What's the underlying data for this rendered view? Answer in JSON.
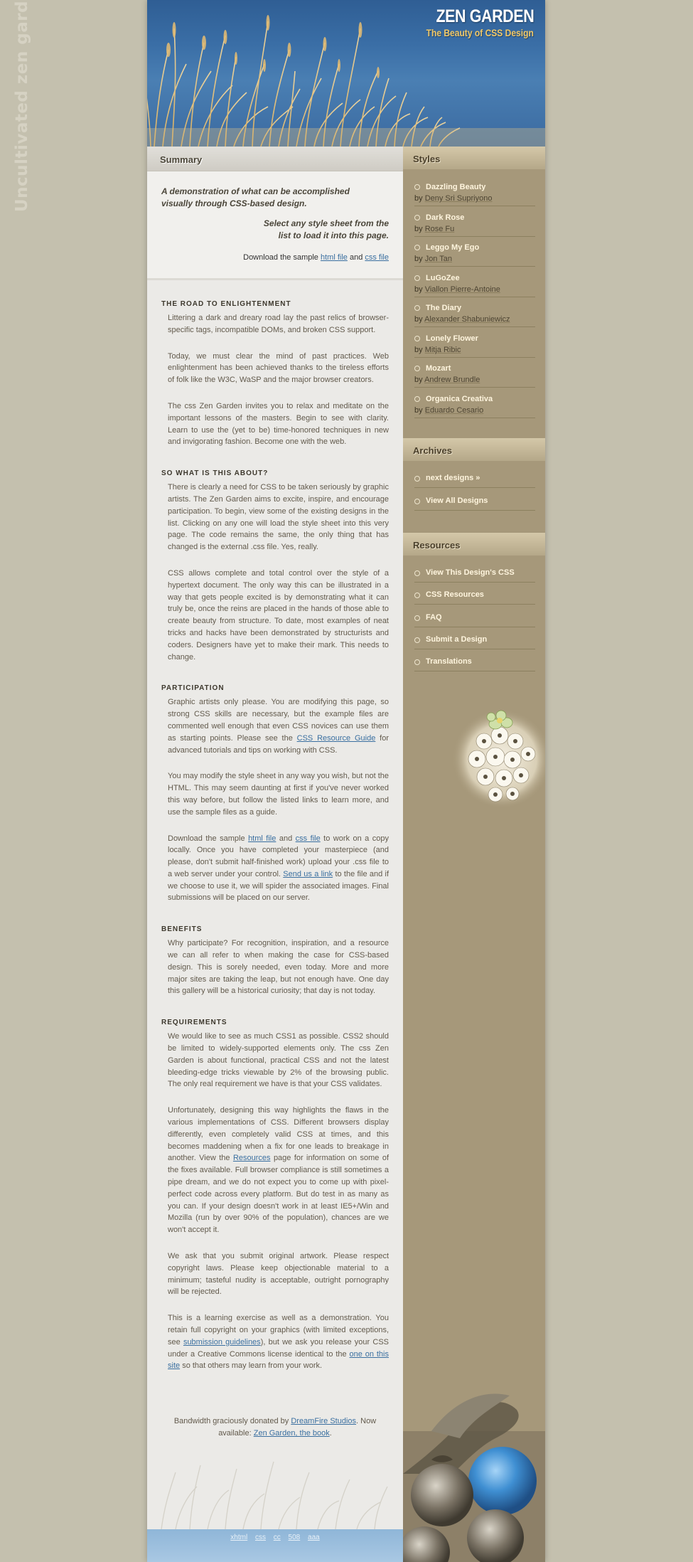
{
  "watermark": "Uncultivated zen garden",
  "header": {
    "title": "ZEN GARDEN",
    "tagline": "The Beauty of CSS Design"
  },
  "summary": {
    "heading": "Summary",
    "intro": "A demonstration of what can be accomplished visually through CSS-based design.",
    "instruction": "Select any style sheet from the list to load it into this page.",
    "download_pre": "Download the sample",
    "html_file": "html file",
    "and": "and",
    "css_file": "css file"
  },
  "sections": {
    "road": {
      "title": "THE ROAD TO ENLIGHTENMENT",
      "p1": "Littering a dark and dreary road lay the past relics of browser-specific tags, incompatible DOMs, and broken CSS support.",
      "p2": "Today, we must clear the mind of past practices. Web enlightenment has been achieved thanks to the tireless efforts of folk like the W3C, WaSP and the major browser creators.",
      "p3": "The css Zen Garden invites you to relax and meditate on the important lessons of the masters. Begin to see with clarity. Learn to use the (yet to be) time-honored techniques in new and invigorating fashion. Become one with the web."
    },
    "about": {
      "title": "SO WHAT IS THIS ABOUT?",
      "p1": "There is clearly a need for CSS to be taken seriously by graphic artists. The Zen Garden aims to excite, inspire, and encourage participation. To begin, view some of the existing designs in the list. Clicking on any one will load the style sheet into this very page. The code remains the same, the only thing that has changed is the external .css file. Yes, really.",
      "p2": "CSS allows complete and total control over the style of a hypertext document. The only way this can be illustrated in a way that gets people excited is by demonstrating what it can truly be, once the reins are placed in the hands of those able to create beauty from structure. To date, most examples of neat tricks and hacks have been demonstrated by structurists and coders. Designers have yet to make their mark. This needs to change."
    },
    "participation": {
      "title": "PARTICIPATION",
      "p1_a": "Graphic artists only please. You are modifying this page, so strong CSS skills are necessary, but the example files are commented well enough that even CSS novices can use them as starting points. Please see the",
      "p1_link": "CSS Resource Guide",
      "p1_b": "for advanced tutorials and tips on working with CSS.",
      "p2": "You may modify the style sheet in any way you wish, but not the HTML. This may seem daunting at first if you've never worked this way before, but follow the listed links to learn more, and use the sample files as a guide.",
      "p3_a": "Download the sample",
      "p3_html": "html file",
      "p3_and": "and",
      "p3_css": "css file",
      "p3_b": "to work on a copy locally. Once you have completed your masterpiece (and please, don't submit half-finished work) upload your .css file to a web server under your control.",
      "p3_link": "Send us a link",
      "p3_c": "to the file and if we choose to use it, we will spider the associated images. Final submissions will be placed on our server."
    },
    "benefits": {
      "title": "BENEFITS",
      "p1": "Why participate? For recognition, inspiration, and a resource we can all refer to when making the case for CSS-based design. This is sorely needed, even today. More and more major sites are taking the leap, but not enough have. One day this gallery will be a historical curiosity; that day is not today."
    },
    "requirements": {
      "title": "REQUIREMENTS",
      "p1": "We would like to see as much CSS1 as possible. CSS2 should be limited to widely-supported elements only. The css Zen Garden is about functional, practical CSS and not the latest bleeding-edge tricks viewable by 2% of the browsing public. The only real requirement we have is that your CSS validates.",
      "p2_a": "Unfortunately, designing this way highlights the flaws in the various implementations of CSS. Different browsers display differently, even completely valid CSS at times, and this becomes maddening when a fix for one leads to breakage in another. View the",
      "p2_link": "Resources",
      "p2_b": "page for information on some of the fixes available. Full browser compliance is still sometimes a pipe dream, and we do not expect you to come up with pixel-perfect code across every platform. But do test in as many as you can. If your design doesn't work in at least IE5+/Win and Mozilla (run by over 90% of the population), chances are we won't accept it.",
      "p3": "We ask that you submit original artwork. Please respect copyright laws. Please keep objectionable material to a minimum; tasteful nudity is acceptable, outright pornography will be rejected.",
      "p4_a": "This is a learning exercise as well as a demonstration. You retain full copyright on your graphics (with limited exceptions, see",
      "p4_link1": "submission guidelines",
      "p4_b": "), but we ask you release your CSS under a Creative Commons license identical to the",
      "p4_link2": "one on this site",
      "p4_c": "so that others may learn from your work."
    }
  },
  "credits": {
    "pre": "Bandwidth graciously donated by",
    "host": "DreamFire Studios",
    "mid": ". Now available:",
    "book": "Zen Garden, the book",
    "end": "."
  },
  "footer_links": [
    "xhtml",
    "css",
    "cc",
    "508",
    "aaa"
  ],
  "sidebar": {
    "styles_heading": "Styles",
    "by": "by",
    "styles": [
      {
        "name": "Dazzling Beauty",
        "author": "Deny Sri Supriyono"
      },
      {
        "name": "Dark Rose",
        "author": "Rose Fu"
      },
      {
        "name": "Leggo My Ego",
        "author": "Jon Tan"
      },
      {
        "name": "LuGoZee",
        "author": "Viallon Pierre-Antoine"
      },
      {
        "name": "The Diary",
        "author": "Alexander Shabuniewicz"
      },
      {
        "name": "Lonely Flower",
        "author": "Mitja Ribic"
      },
      {
        "name": "Mozart",
        "author": "Andrew Brundle"
      },
      {
        "name": "Organica Creativa",
        "author": "Eduardo Cesario"
      }
    ],
    "archives_heading": "Archives",
    "archives": [
      "next designs »",
      "View All Designs"
    ],
    "resources_heading": "Resources",
    "resources": [
      "View This Design's CSS",
      "CSS Resources",
      "FAQ",
      "Submit a Design",
      "Translations"
    ]
  },
  "colors": {
    "accent_link": "#3a6fa0",
    "sidebar_bg": "#a6987a",
    "main_bg": "#ebeae7"
  }
}
